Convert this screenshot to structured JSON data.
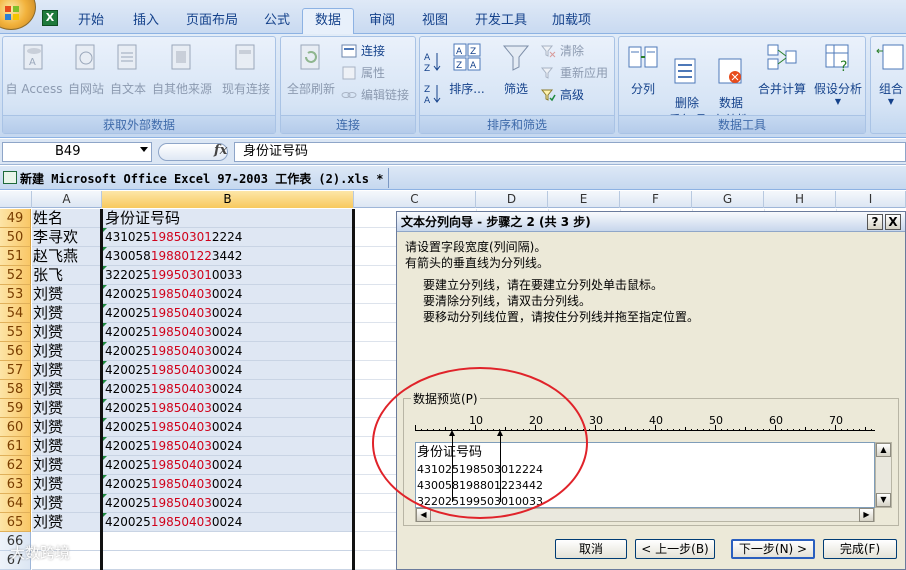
{
  "ribbon": {
    "tabs": [
      "开始",
      "插入",
      "页面布局",
      "公式",
      "数据",
      "审阅",
      "视图",
      "开发工具",
      "加载项"
    ],
    "active_tab": "数据",
    "groups": {
      "external": {
        "label": "获取外部数据",
        "buttons": [
          "自 Access",
          "自网站",
          "自文本",
          "自其他来源",
          "现有连接"
        ]
      },
      "connections": {
        "label": "连接",
        "refresh_label": "全部刷新",
        "small": [
          "连接",
          "属性",
          "编辑链接"
        ]
      },
      "sortfilter": {
        "label": "排序和筛选",
        "sort_label": "排序...",
        "filter_label": "筛选",
        "small": [
          "清除",
          "重新应用",
          "高级"
        ]
      },
      "datatools": {
        "label": "数据工具",
        "buttons": [
          "分列",
          "删除\n重复项",
          "数据\n有效性",
          "合并计算",
          "假设分析"
        ]
      },
      "outline": {
        "buttons": [
          "组合"
        ]
      }
    }
  },
  "formula_bar": {
    "name_box": "B49",
    "fx": "fx",
    "formula": "身份证号码"
  },
  "workbook": {
    "title": "新建 Microsoft Office Excel 97-2003 工作表 (2).xls *"
  },
  "grid": {
    "columns": [
      "A",
      "B",
      "C",
      "D",
      "E",
      "F",
      "G",
      "H",
      "I"
    ],
    "rows": [
      {
        "num": "49",
        "a": "姓名",
        "b_pre": "身份证号码",
        "b_red": "",
        "b_post": "",
        "hdr": true
      },
      {
        "num": "50",
        "a": "李寻欢",
        "b_pre": "431025",
        "b_red": "19850301",
        "b_post": "2224"
      },
      {
        "num": "51",
        "a": "赵飞燕",
        "b_pre": "430058",
        "b_red": "19880122",
        "b_post": "3442"
      },
      {
        "num": "52",
        "a": "张飞",
        "b_pre": "322025",
        "b_red": "19950301",
        "b_post": "0033"
      },
      {
        "num": "53",
        "a": "刘赟",
        "b_pre": "420025",
        "b_red": "19850403",
        "b_post": "0024"
      },
      {
        "num": "54",
        "a": "刘赟",
        "b_pre": "420025",
        "b_red": "19850403",
        "b_post": "0024"
      },
      {
        "num": "55",
        "a": "刘赟",
        "b_pre": "420025",
        "b_red": "19850403",
        "b_post": "0024"
      },
      {
        "num": "56",
        "a": "刘赟",
        "b_pre": "420025",
        "b_red": "19850403",
        "b_post": "0024"
      },
      {
        "num": "57",
        "a": "刘赟",
        "b_pre": "420025",
        "b_red": "19850403",
        "b_post": "0024"
      },
      {
        "num": "58",
        "a": "刘赟",
        "b_pre": "420025",
        "b_red": "19850403",
        "b_post": "0024"
      },
      {
        "num": "59",
        "a": "刘赟",
        "b_pre": "420025",
        "b_red": "19850403",
        "b_post": "0024"
      },
      {
        "num": "60",
        "a": "刘赟",
        "b_pre": "420025",
        "b_red": "19850403",
        "b_post": "0024"
      },
      {
        "num": "61",
        "a": "刘赟",
        "b_pre": "420025",
        "b_red": "19850403",
        "b_post": "0024"
      },
      {
        "num": "62",
        "a": "刘赟",
        "b_pre": "420025",
        "b_red": "19850403",
        "b_post": "0024"
      },
      {
        "num": "63",
        "a": "刘赟",
        "b_pre": "420025",
        "b_red": "19850403",
        "b_post": "0024"
      },
      {
        "num": "64",
        "a": "刘赟",
        "b_pre": "420025",
        "b_red": "19850403",
        "b_post": "0024"
      },
      {
        "num": "65",
        "a": "刘赟",
        "b_pre": "420025",
        "b_red": "19850403",
        "b_post": "0024"
      },
      {
        "num": "66",
        "a": "",
        "b_pre": "",
        "b_red": "",
        "b_post": ""
      },
      {
        "num": "67",
        "a": "",
        "b_pre": "",
        "b_red": "",
        "b_post": ""
      }
    ]
  },
  "dialog": {
    "title": "文本分列向导 - 步骤之 2 (共 3 步)",
    "help": "?",
    "close": "X",
    "line1": "请设置字段宽度(列间隔)。",
    "line2": "有箭头的垂直线为分列线。",
    "line3": "要建立分列线，请在要建立分列处单击鼠标。",
    "line4": "要清除分列线，请双击分列线。",
    "line5": "要移动分列线位置，请按住分列线并拖至指定位置。",
    "preview_label": "数据预览(P)",
    "ruler": [
      "10",
      "20",
      "30",
      "40",
      "50",
      "60",
      "70"
    ],
    "preview": [
      "身份证号码",
      "431025198503012224",
      "430058198801223442",
      "322025199503010033"
    ],
    "buttons": {
      "cancel": "取消",
      "back": "< 上一步(B)",
      "next": "下一步(N) >",
      "finish": "完成(F)"
    }
  },
  "watermark": "大数跨境"
}
